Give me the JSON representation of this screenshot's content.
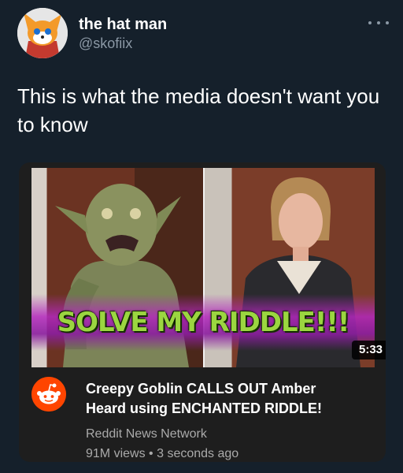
{
  "tweet": {
    "author_name": "the hat man",
    "author_handle": "@skofiix",
    "text": "This is what the media doesn't want you to know"
  },
  "video_card": {
    "thumbnail_caption": "SOLVE MY RIDDLE!!!",
    "duration": "5:33",
    "title": "Creepy Goblin CALLS OUT Amber Heard using ENCHANTED RIDDLE!",
    "channel": "Reddit News Network",
    "views": "91M views",
    "separator": "•",
    "age": "3 seconds ago"
  },
  "icons": {
    "more": "more-options-icon",
    "channel_logo": "reddit-logo-icon"
  },
  "colors": {
    "background": "#15202b",
    "secondary_text": "#8b98a5",
    "card_background": "#1e1e1e",
    "reddit_orange": "#ff4500",
    "caption_green": "#9bd640"
  }
}
